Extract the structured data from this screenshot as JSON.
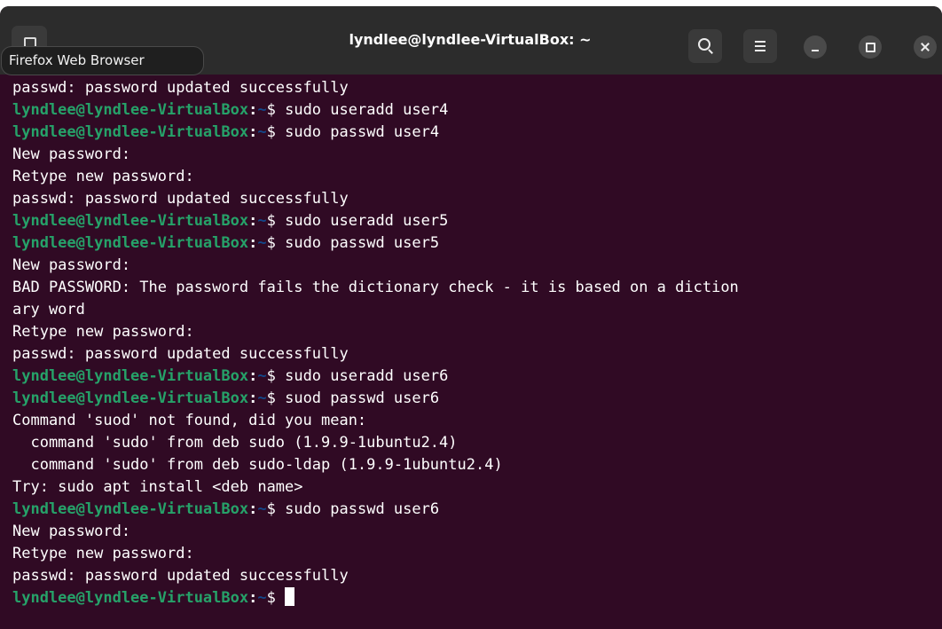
{
  "window": {
    "title": "lyndlee@lyndlee-VirtualBox: ~"
  },
  "tooltip": {
    "text": "Firefox Web Browser"
  },
  "colors": {
    "terminal_bg": "#300a24",
    "titlebar_bg": "#2c2c2c",
    "prompt_user": "#26a269",
    "prompt_path": "#12488b"
  },
  "icons": {
    "new_tab": "new-tab-icon",
    "search": "search-icon",
    "menu": "hamburger-menu-icon",
    "minimize": "minimize-icon",
    "maximize": "maximize-icon",
    "close": "close-icon"
  },
  "prompt": {
    "user": "lyndlee@lyndlee-VirtualBox",
    "sep": ":",
    "path": "~",
    "dollar": "$ "
  },
  "lines": [
    {
      "type": "output",
      "text": "passwd: password updated successfully"
    },
    {
      "type": "prompt",
      "cmd": "sudo useradd user4"
    },
    {
      "type": "prompt",
      "cmd": "sudo passwd user4"
    },
    {
      "type": "output",
      "text": "New password:"
    },
    {
      "type": "output",
      "text": "Retype new password:"
    },
    {
      "type": "output",
      "text": "passwd: password updated successfully"
    },
    {
      "type": "prompt",
      "cmd": "sudo useradd user5"
    },
    {
      "type": "prompt",
      "cmd": "sudo passwd user5"
    },
    {
      "type": "output",
      "text": "New password:"
    },
    {
      "type": "output",
      "text": "BAD PASSWORD: The password fails the dictionary check - it is based on a diction"
    },
    {
      "type": "output",
      "text": "ary word"
    },
    {
      "type": "output",
      "text": "Retype new password:"
    },
    {
      "type": "output",
      "text": "passwd: password updated successfully"
    },
    {
      "type": "prompt",
      "cmd": "sudo useradd user6"
    },
    {
      "type": "prompt",
      "cmd": "suod passwd user6"
    },
    {
      "type": "output",
      "text": "Command 'suod' not found, did you mean:"
    },
    {
      "type": "output",
      "text": "  command 'sudo' from deb sudo (1.9.9-1ubuntu2.4)"
    },
    {
      "type": "output",
      "text": "  command 'sudo' from deb sudo-ldap (1.9.9-1ubuntu2.4)"
    },
    {
      "type": "output",
      "text": "Try: sudo apt install <deb name>"
    },
    {
      "type": "prompt",
      "cmd": "sudo passwd user6"
    },
    {
      "type": "output",
      "text": "New password:"
    },
    {
      "type": "output",
      "text": "Retype new password:"
    },
    {
      "type": "output",
      "text": "passwd: password updated successfully"
    },
    {
      "type": "prompt",
      "cmd": "",
      "cursor": true
    }
  ]
}
